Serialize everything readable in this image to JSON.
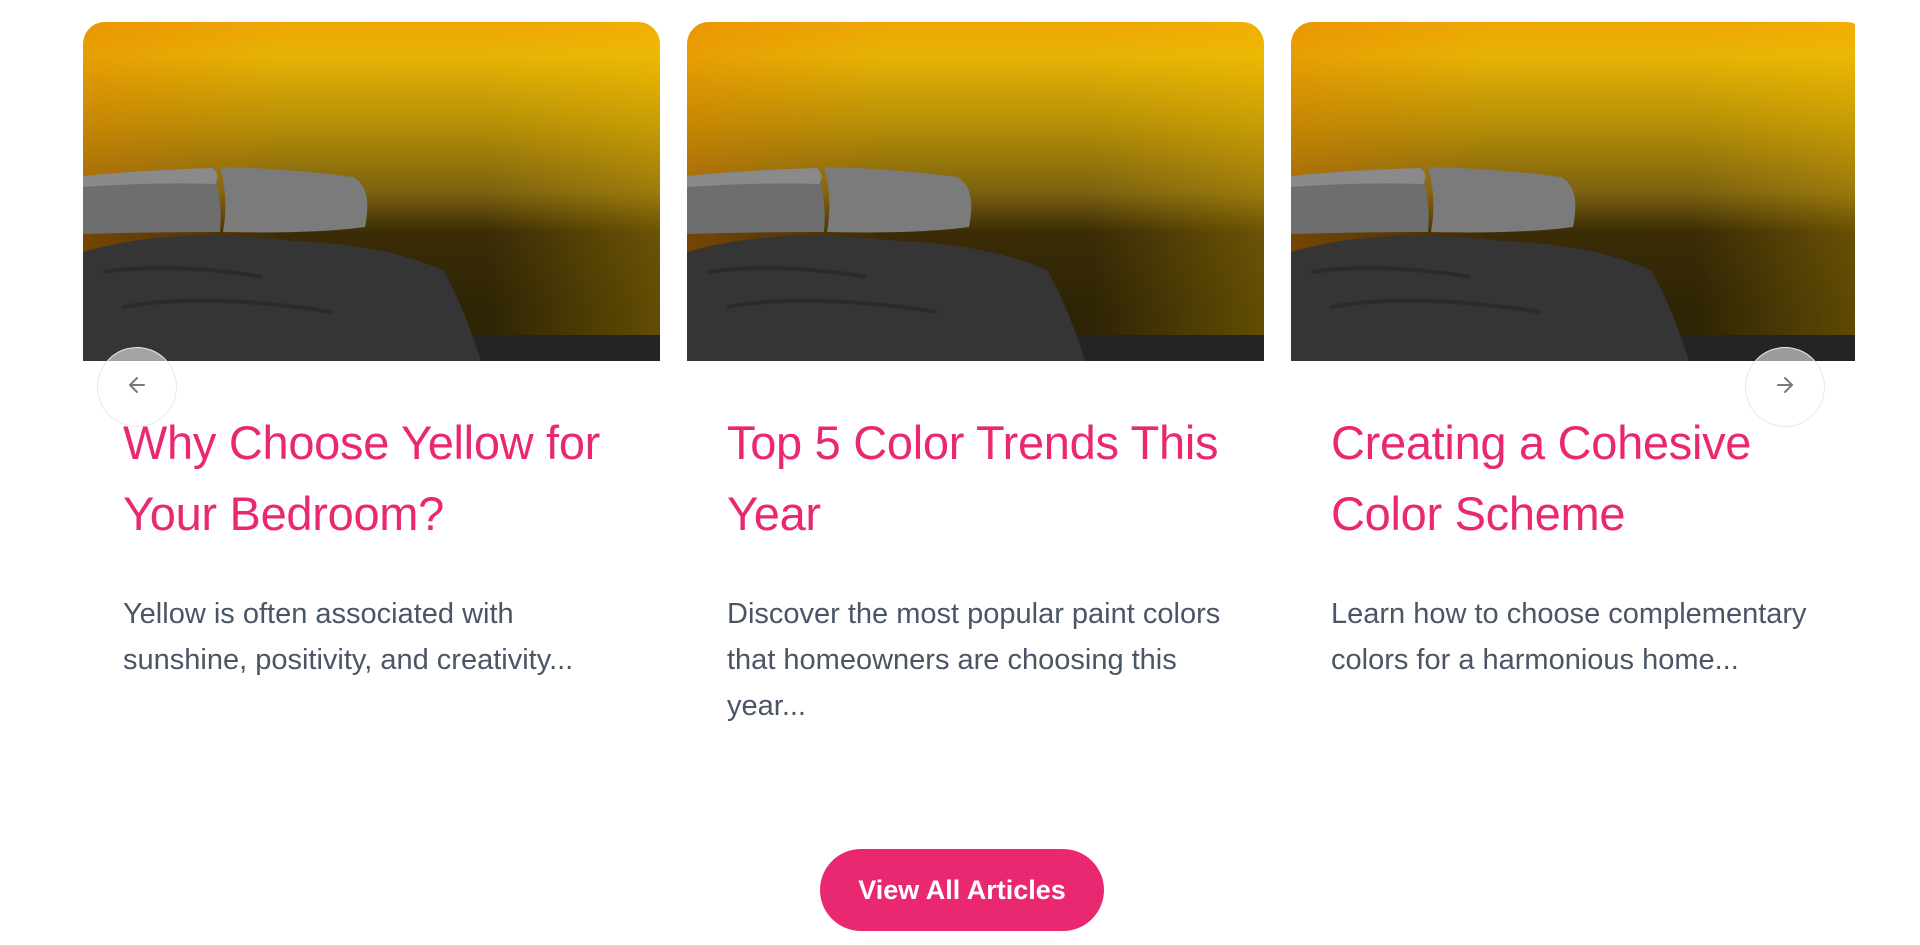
{
  "articles": [
    {
      "title": "Why Choose Yellow for Your Bedroom?",
      "excerpt": "Yellow is often associated with sunshine, positivity, and creativity..."
    },
    {
      "title": "Top 5 Color Trends This Year",
      "excerpt": "Discover the most popular paint colors that homeowners are choosing this year..."
    },
    {
      "title": "Creating a Cohesive Color Scheme",
      "excerpt": "Learn how to choose complementary colors for a harmonious home..."
    }
  ],
  "navigation": {
    "prev_icon": "arrow-left-icon",
    "next_icon": "arrow-right-icon"
  },
  "cta": {
    "label": "View All Articles"
  },
  "colors": {
    "accent": "#ea2871",
    "body_text": "#4a5566",
    "image_yellow": "#efb303"
  }
}
